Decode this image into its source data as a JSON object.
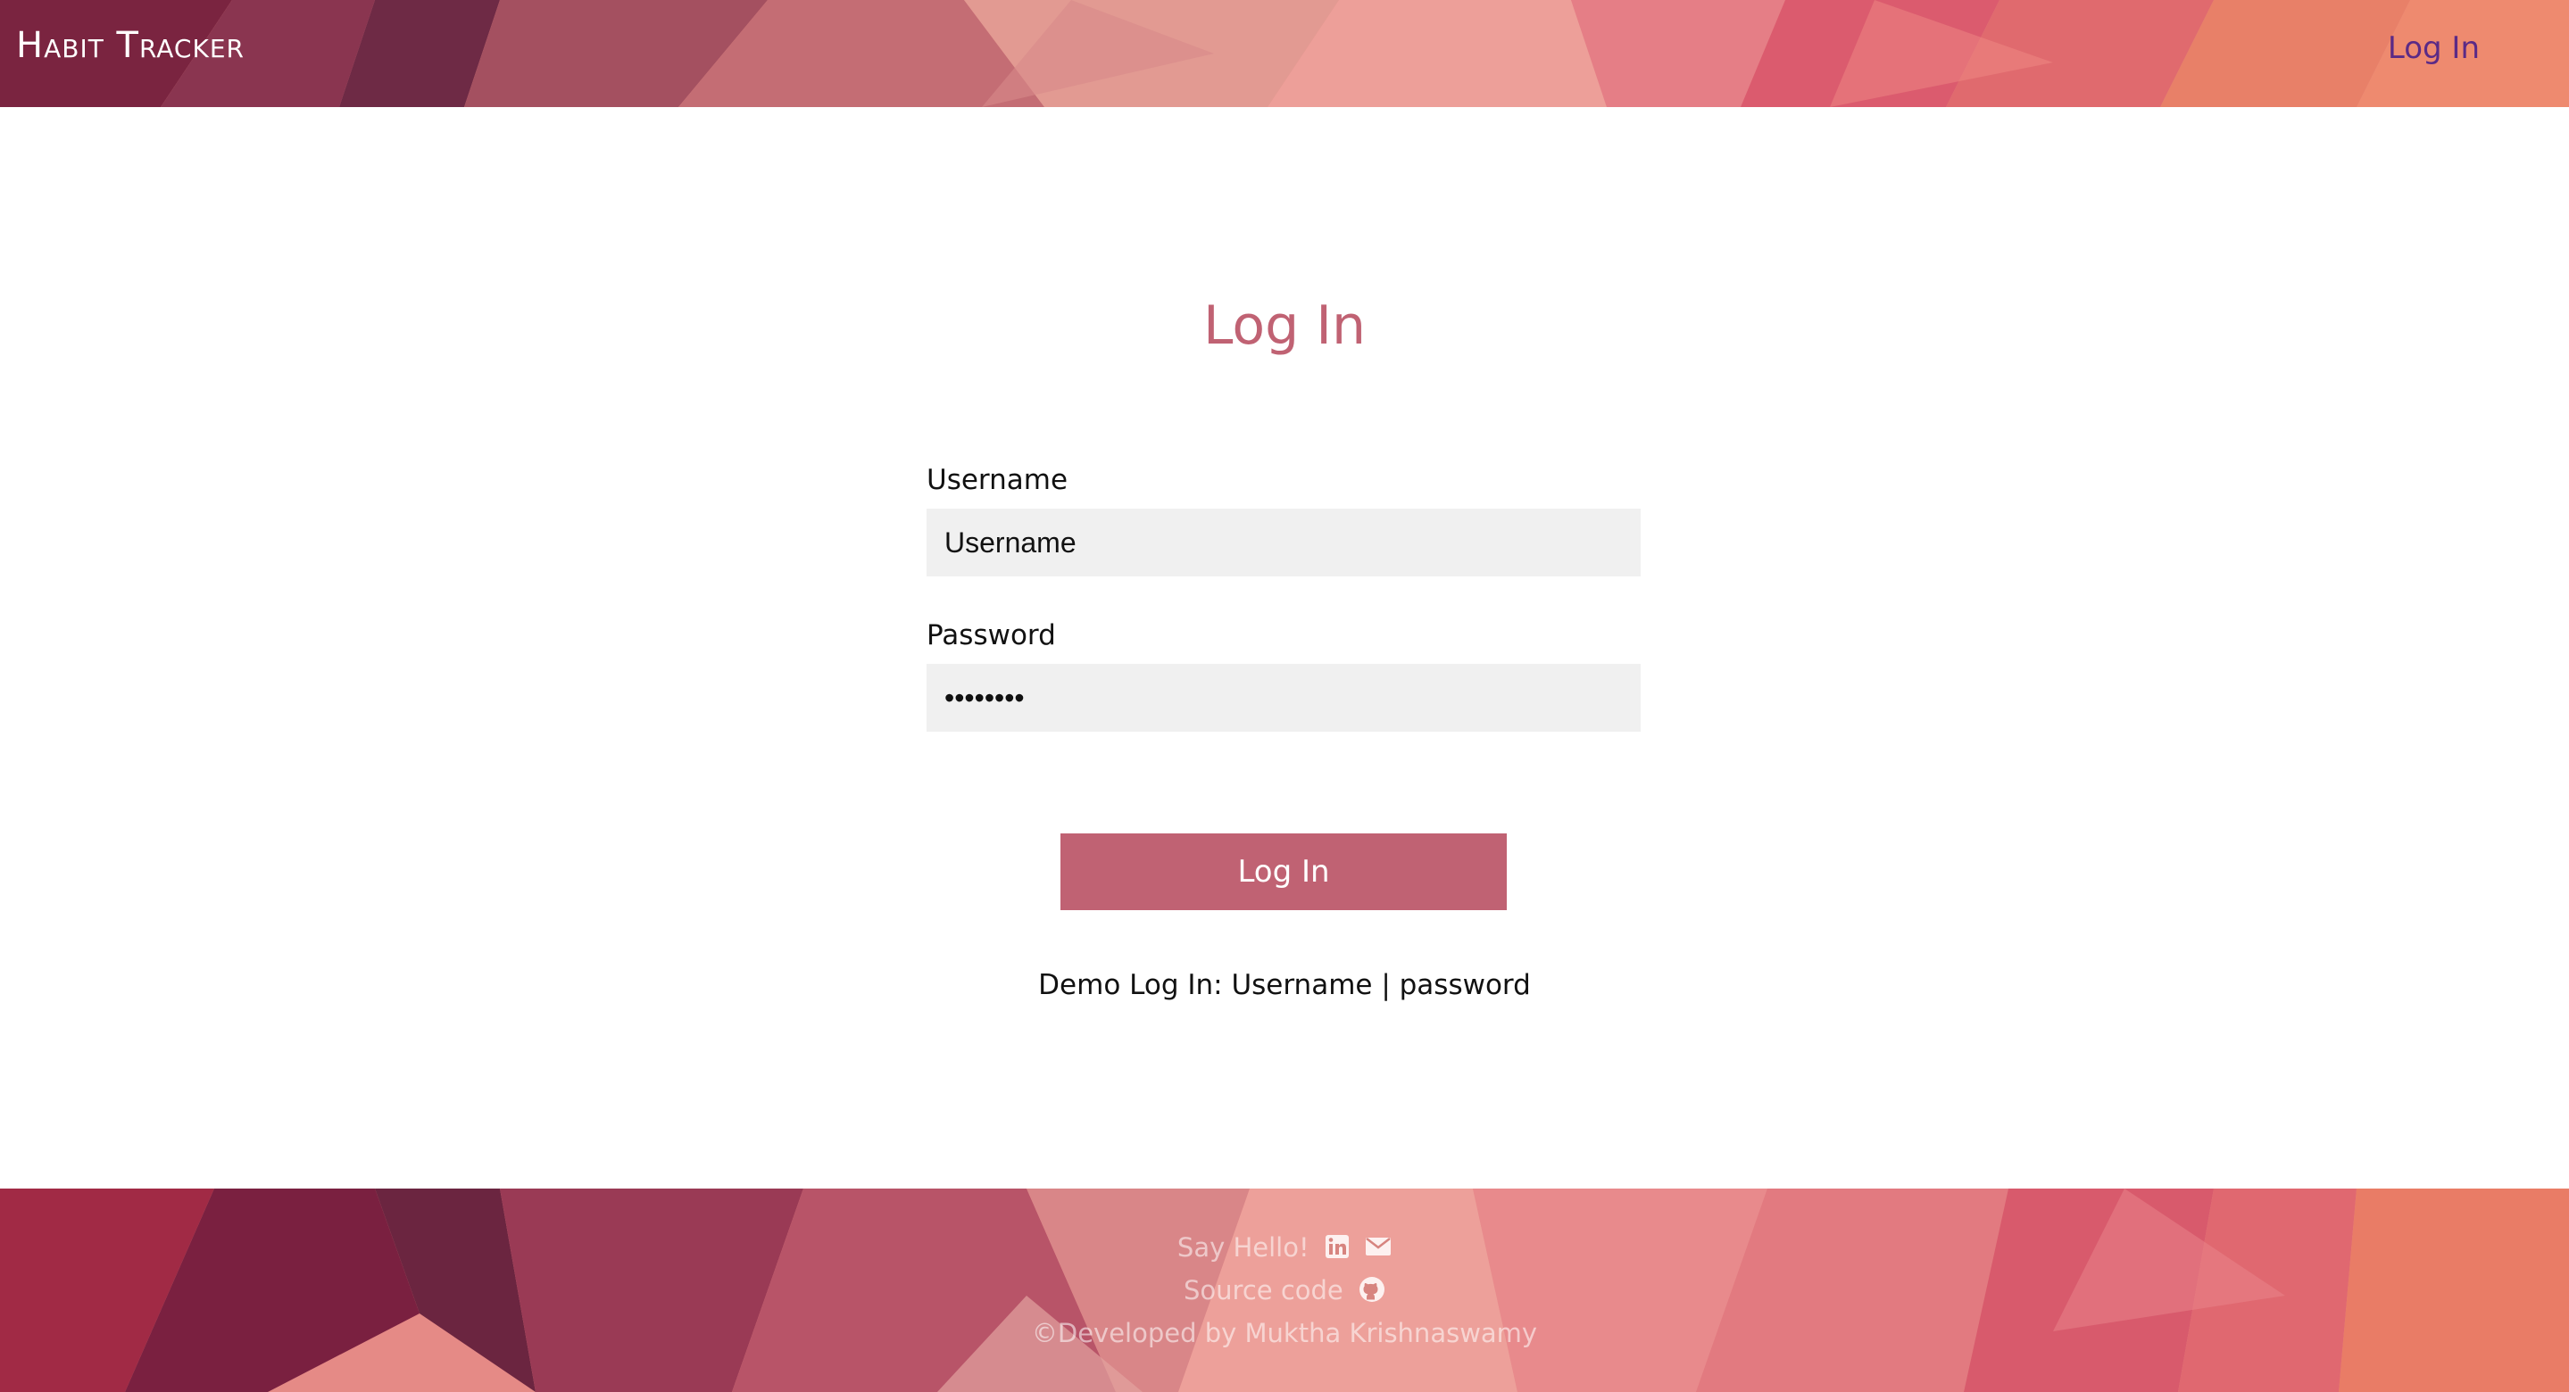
{
  "header": {
    "brand": "Habit Tracker",
    "nav_login_label": "Log In"
  },
  "main": {
    "title": "Log In",
    "username": {
      "label": "Username",
      "placeholder": "Username",
      "value": ""
    },
    "password": {
      "label": "Password",
      "value": "••••••••"
    },
    "submit_label": "Log In",
    "demo_text": "Demo Log In: Username | password"
  },
  "footer": {
    "say_hello": "Say Hello!",
    "source_code": "Source code",
    "credit": "©Developed by Muktha Krishnaswamy",
    "icons": [
      "linkedin-icon",
      "email-icon",
      "github-icon"
    ]
  },
  "colors": {
    "accent": "#c06273",
    "nav_link": "#5b2a86",
    "input_bg": "#f0f0f0"
  }
}
